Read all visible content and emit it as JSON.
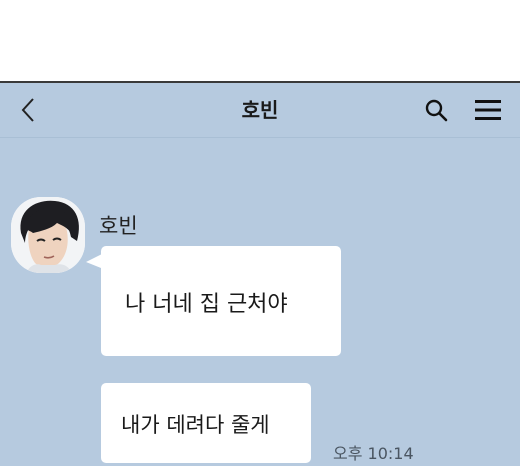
{
  "header": {
    "title": "호빈",
    "back_icon": "chevron-left-icon",
    "search_icon": "search-icon",
    "menu_icon": "hamburger-menu-icon"
  },
  "colors": {
    "chat_background": "#b6cadf",
    "bubble_background": "#ffffff",
    "text": "#1a1a1a"
  },
  "messages": [
    {
      "sender": "호빈",
      "text": "나 너네 집 근처야"
    },
    {
      "text": "내가 데려다 줄게",
      "time": "오후 10:14"
    }
  ]
}
